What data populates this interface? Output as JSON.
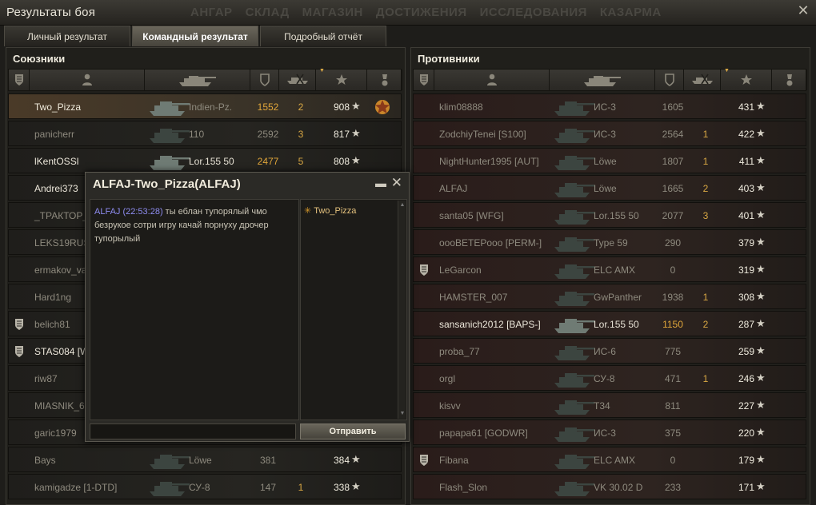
{
  "window": {
    "title": "Результаты боя",
    "close_glyph": "✕"
  },
  "ghost_menu": [
    "АНГАР",
    "СКЛАД",
    "МАГАЗИН",
    "ДОСТИЖЕНИЯ",
    "ИССЛЕДОВАНИЯ",
    "КАЗАРМА"
  ],
  "tabs": [
    {
      "label": "Личный результат",
      "active": false
    },
    {
      "label": "Командный результат",
      "active": true
    },
    {
      "label": "Подробный отчёт",
      "active": false
    }
  ],
  "allies": {
    "title": "Союзники",
    "rows": [
      {
        "name": "Two_Pizza",
        "vehicle": "Indien-Pz.",
        "damage": "1552",
        "kills": "2",
        "xp": "908",
        "state": "me",
        "badge": false,
        "medal": true
      },
      {
        "name": "panicherr",
        "vehicle": "110",
        "damage": "2592",
        "kills": "3",
        "xp": "817",
        "state": "dead",
        "badge": false,
        "medal": false
      },
      {
        "name": "lKentOSSl",
        "vehicle": "Lor.155 50",
        "damage": "2477",
        "kills": "5",
        "xp": "808",
        "state": "alive",
        "badge": false,
        "medal": false
      },
      {
        "name": "Andrei373",
        "vehicle": "",
        "damage": "",
        "kills": "",
        "xp": "",
        "state": "alive",
        "badge": false,
        "medal": false
      },
      {
        "name": "_ТРАКТОР_",
        "vehicle": "",
        "damage": "",
        "kills": "",
        "xp": "",
        "state": "dead",
        "badge": false,
        "medal": false
      },
      {
        "name": "LEKS19RUS",
        "vehicle": "",
        "damage": "",
        "kills": "",
        "xp": "",
        "state": "dead",
        "badge": false,
        "medal": false
      },
      {
        "name": "ermakov_va",
        "vehicle": "",
        "damage": "",
        "kills": "",
        "xp": "",
        "state": "dead",
        "badge": false,
        "medal": false
      },
      {
        "name": "Hard1ng",
        "vehicle": "",
        "damage": "",
        "kills": "",
        "xp": "",
        "state": "dead",
        "badge": false,
        "medal": false
      },
      {
        "name": "belich81",
        "vehicle": "",
        "damage": "",
        "kills": "",
        "xp": "",
        "state": "dead",
        "badge": true,
        "medal": false
      },
      {
        "name": "STAS084 [W",
        "vehicle": "",
        "damage": "",
        "kills": "",
        "xp": "",
        "state": "alive",
        "badge": true,
        "medal": false
      },
      {
        "name": "riw87",
        "vehicle": "",
        "damage": "",
        "kills": "",
        "xp": "",
        "state": "dead",
        "badge": false,
        "medal": false
      },
      {
        "name": "MIASNIK_6",
        "vehicle": "",
        "damage": "",
        "kills": "",
        "xp": "",
        "state": "dead",
        "badge": false,
        "medal": false
      },
      {
        "name": "garic1979",
        "vehicle": "",
        "damage": "",
        "kills": "",
        "xp": "",
        "state": "dead",
        "badge": false,
        "medal": false
      },
      {
        "name": "Bays",
        "vehicle": "Löwe",
        "damage": "381",
        "kills": "",
        "xp": "384",
        "state": "dead",
        "badge": false,
        "medal": false
      },
      {
        "name": "kamigadze [1-DTD]",
        "vehicle": "СУ-8",
        "damage": "147",
        "kills": "1",
        "xp": "338",
        "state": "dead",
        "badge": false,
        "medal": false
      }
    ]
  },
  "enemies": {
    "title": "Противники",
    "rows": [
      {
        "name": "klim08888",
        "vehicle": "ИС-3",
        "damage": "1605",
        "kills": "",
        "xp": "431",
        "state": "dead",
        "badge": false
      },
      {
        "name": "ZodchiyTenei [S100]",
        "vehicle": "ИС-3",
        "damage": "2564",
        "kills": "1",
        "xp": "422",
        "state": "dead",
        "badge": false
      },
      {
        "name": "NightHunter1995 [AUT]",
        "vehicle": "Löwe",
        "damage": "1807",
        "kills": "1",
        "xp": "411",
        "state": "dead",
        "badge": false
      },
      {
        "name": "ALFAJ",
        "vehicle": "Löwe",
        "damage": "1665",
        "kills": "2",
        "xp": "403",
        "state": "dead",
        "badge": false
      },
      {
        "name": "santa05 [WFG]",
        "vehicle": "Lor.155 50",
        "damage": "2077",
        "kills": "3",
        "xp": "401",
        "state": "dead",
        "badge": false
      },
      {
        "name": "oooBETEPooo [PERM-]",
        "vehicle": "Type 59",
        "damage": "290",
        "kills": "",
        "xp": "379",
        "state": "dead",
        "badge": false
      },
      {
        "name": "LeGarcon",
        "vehicle": "ELC AMX",
        "damage": "0",
        "kills": "",
        "xp": "319",
        "state": "dead",
        "badge": true
      },
      {
        "name": "HAMSTER_007",
        "vehicle": "GwPanther",
        "damage": "1938",
        "kills": "1",
        "xp": "308",
        "state": "dead",
        "badge": false
      },
      {
        "name": "sansanich2012 [BAPS-]",
        "vehicle": "Lor.155 50",
        "damage": "1150",
        "kills": "2",
        "xp": "287",
        "state": "alive",
        "badge": false
      },
      {
        "name": "proba_77",
        "vehicle": "ИС-6",
        "damage": "775",
        "kills": "",
        "xp": "259",
        "state": "dead",
        "badge": false
      },
      {
        "name": "orgl",
        "vehicle": "СУ-8",
        "damage": "471",
        "kills": "1",
        "xp": "246",
        "state": "dead",
        "badge": false
      },
      {
        "name": "kisvv",
        "vehicle": "T34",
        "damage": "811",
        "kills": "",
        "xp": "227",
        "state": "dead",
        "badge": false
      },
      {
        "name": "papapa61 [GODWR]",
        "vehicle": "ИС-3",
        "damage": "375",
        "kills": "",
        "xp": "220",
        "state": "dead",
        "badge": false
      },
      {
        "name": "Fibana",
        "vehicle": "ELC AMX",
        "damage": "0",
        "kills": "",
        "xp": "179",
        "state": "dead",
        "badge": true
      },
      {
        "name": "Flash_Slon",
        "vehicle": "VK 30.02 D",
        "damage": "233",
        "kills": "",
        "xp": "171",
        "state": "dead",
        "badge": false
      }
    ]
  },
  "chat": {
    "title": "ALFAJ-Two_Pizza(ALFAJ)",
    "message": {
      "sender": "ALFAJ (22:53:28)",
      "text": "ты еблан тупорялый чмо безрукое сотри игру качай порнуху дрочер тупорылый"
    },
    "member": "Two_Pizza",
    "send_label": "Отправить",
    "input_value": ""
  },
  "colors": {
    "accent": "#e0a63a",
    "sender": "#8e8cf0",
    "member": "#e5c27e"
  },
  "icons": [
    "shield-icon",
    "person-icon",
    "tank-icon",
    "damage-icon",
    "kills-icon",
    "star-icon",
    "medal-icon"
  ]
}
